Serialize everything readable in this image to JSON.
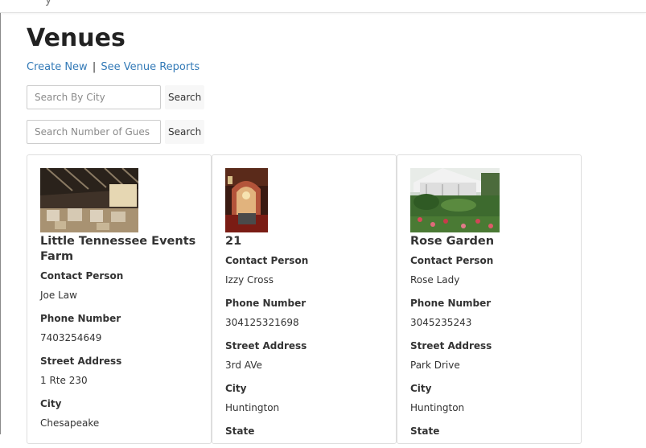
{
  "header": {
    "brand_fragment": "y",
    "toggle_fragment": ""
  },
  "page": {
    "title": "Venues",
    "links": {
      "create_new": "Create New",
      "separator": "|",
      "see_reports": "See Venue Reports"
    }
  },
  "searches": [
    {
      "placeholder": "Search By City",
      "button_label": "Search"
    },
    {
      "placeholder": "Search Number of Gues",
      "button_label": "Search"
    }
  ],
  "venues": [
    {
      "name": "Little Tennessee Events Farm",
      "fields": [
        {
          "label": "Contact Person",
          "value": "Joe Law"
        },
        {
          "label": "Phone Number",
          "value": "7403254649"
        },
        {
          "label": "Street Address",
          "value": "1 Rte 230"
        },
        {
          "label": "City",
          "value": "Chesapeake"
        }
      ]
    },
    {
      "name": "21",
      "fields": [
        {
          "label": "Contact Person",
          "value": "Izzy Cross"
        },
        {
          "label": "Phone Number",
          "value": "304125321698"
        },
        {
          "label": "Street Address",
          "value": "3rd AVe"
        },
        {
          "label": "City",
          "value": "Huntington"
        },
        {
          "label": "State",
          "value": ""
        }
      ]
    },
    {
      "name": "Rose Garden",
      "fields": [
        {
          "label": "Contact Person",
          "value": "Rose Lady"
        },
        {
          "label": "Phone Number",
          "value": "3045235243"
        },
        {
          "label": "Street Address",
          "value": "Park Drive"
        },
        {
          "label": "City",
          "value": "Huntington"
        },
        {
          "label": "State",
          "value": ""
        }
      ]
    }
  ]
}
